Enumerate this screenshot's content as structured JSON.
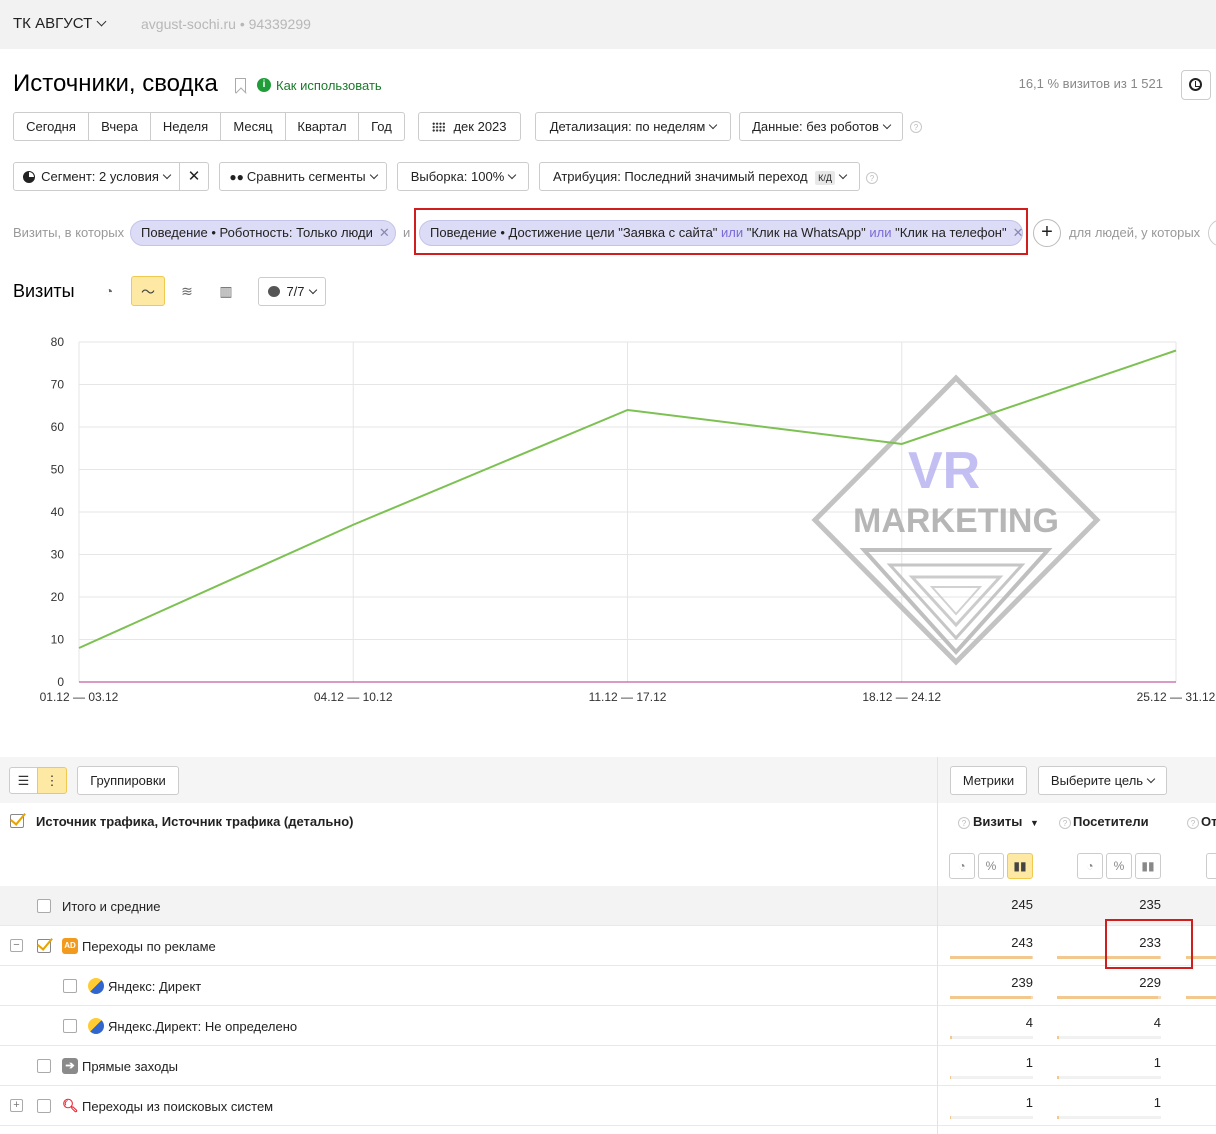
{
  "header": {
    "counter_name": "ТК АВГУСТ",
    "site": "avgust-sochi.ru • 94339299"
  },
  "page": {
    "title": "Источники, сводка",
    "howto": "Как использовать",
    "visits_stat": "16,1 % визитов из 1 521"
  },
  "periods": [
    "Сегодня",
    "Вчера",
    "Неделя",
    "Месяц",
    "Квартал",
    "Год"
  ],
  "toolbar": {
    "date": "дек 2023",
    "detail": "Детализация: по неделям",
    "data": "Данные: без роботов",
    "segment": "Сегмент: 2 условия",
    "compare": "Сравнить сегменты",
    "sample": "Выборка: 100%",
    "attribution": "Атрибуция: Последний значимый переход",
    "attribution_badge": "К/Д"
  },
  "filters": {
    "prefix": "Визиты, в которых",
    "pill1": "Поведение • Роботность: Только люди",
    "and": "и",
    "pill2_a": "Поведение • Достижение цели \"Заявка с сайта\"",
    "pill2_or1": "или",
    "pill2_b": "\"Клик на WhatsApp\"",
    "pill2_or2": "или",
    "pill2_c": "\"Клик на телефон\"",
    "suffix": "для людей, у которых"
  },
  "chart": {
    "title": "Визиты",
    "series_count": "7/7",
    "line_color": "#7cc152",
    "watermark_top": "VR",
    "watermark_bottom": "MARKETING"
  },
  "chart_data": {
    "type": "line",
    "categories": [
      "01.12 — 03.12",
      "04.12 — 10.12",
      "11.12 — 17.12",
      "18.12 — 24.12",
      "25.12 — 31.12"
    ],
    "series": [
      {
        "values": [
          8,
          37,
          64,
          56,
          78
        ]
      }
    ],
    "yticks": [
      0,
      10,
      20,
      30,
      40,
      50,
      60,
      70,
      80
    ],
    "ylim": [
      0,
      80
    ],
    "grid": true
  },
  "table": {
    "groupings": "Группировки",
    "metrics": "Метрики",
    "goal": "Выберите цель",
    "dimension": "Источник трафика, Источник трафика (детально)",
    "col_visits": "Визиты",
    "col_users": "Посетители",
    "col_more": "От",
    "rows": [
      {
        "label": "Итого и средние",
        "visits": "245",
        "users": "235",
        "visits_share": 1,
        "users_share": 1
      },
      {
        "label": "Переходы по рекламе",
        "icon": "AD",
        "visits": "243",
        "users": "233",
        "visits_share": 0.99,
        "users_share": 0.99
      },
      {
        "label": "Яндекс: Директ",
        "visits": "239",
        "users": "229",
        "visits_share": 0.98,
        "users_share": 0.97
      },
      {
        "label": "Яндекс.Директ: Не определено",
        "visits": "4",
        "users": "4",
        "visits_share": 0.02,
        "users_share": 0.02
      },
      {
        "label": "Прямые заходы",
        "visits": "1",
        "users": "1",
        "visits_share": 0.004,
        "users_share": 0.004
      },
      {
        "label": "Переходы из поисковых систем",
        "visits": "1",
        "users": "1",
        "visits_share": 0.004,
        "users_share": 0.004
      }
    ]
  }
}
